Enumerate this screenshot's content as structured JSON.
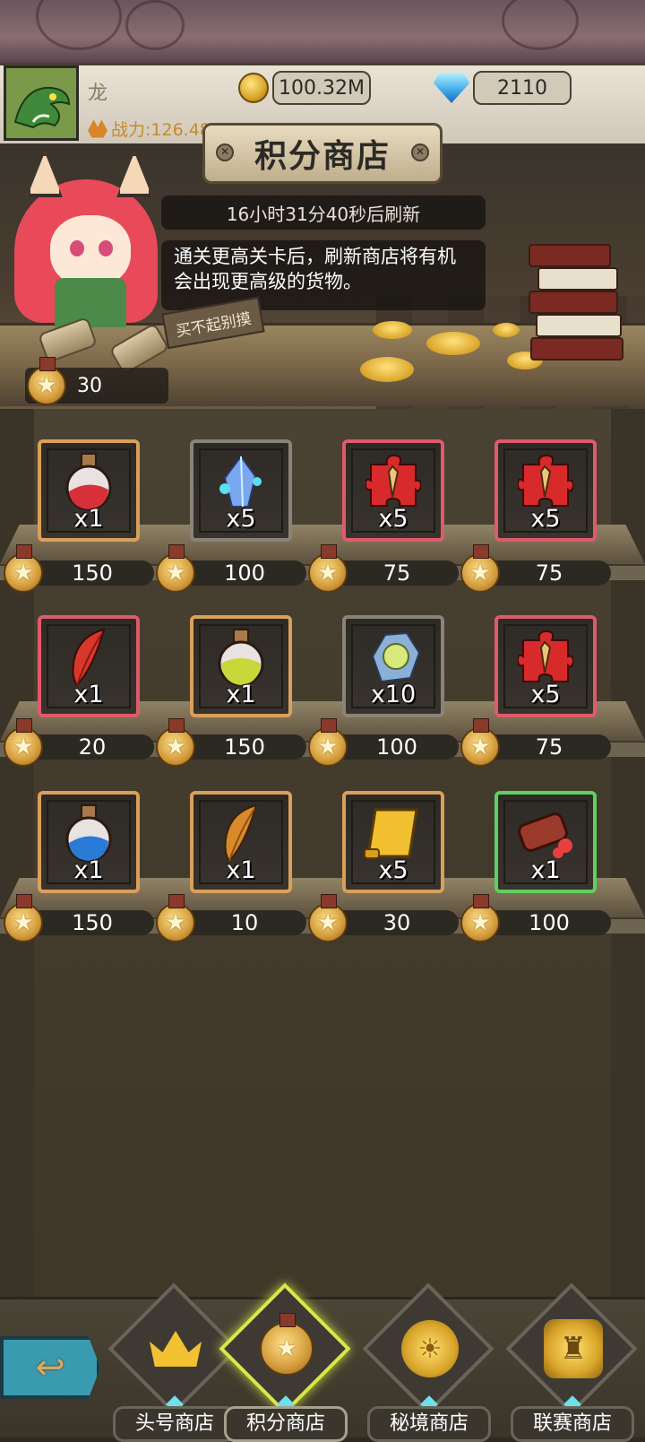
{
  "player": {
    "name": "龙",
    "power": "战力:126.48K"
  },
  "currency": {
    "gold": "100.32M",
    "gems": "2110"
  },
  "shop": {
    "title": "积分商店",
    "refresh_text": "16小时31分40秒后刷新",
    "dialog": "通关更高关卡后，刷新商店将有机会出现更高级的货物。",
    "sign": "买不起别摸",
    "points": "30",
    "items": [
      {
        "icon": "red-potion-icon",
        "qty": "x1",
        "price": "150",
        "rarity": "orange"
      },
      {
        "icon": "blue-crystal-icon",
        "qty": "x5",
        "price": "100",
        "rarity": "gray"
      },
      {
        "icon": "red-puzzle-shard-icon",
        "qty": "x5",
        "price": "75",
        "rarity": "red"
      },
      {
        "icon": "red-puzzle-shard-icon",
        "qty": "x5",
        "price": "75",
        "rarity": "red"
      },
      {
        "icon": "red-feather-icon",
        "qty": "x1",
        "price": "20",
        "rarity": "red"
      },
      {
        "icon": "yellow-potion-icon",
        "qty": "x1",
        "price": "150",
        "rarity": "orange"
      },
      {
        "icon": "gem-ore-icon",
        "qty": "x10",
        "price": "100",
        "rarity": "gray"
      },
      {
        "icon": "red-puzzle-shard-icon",
        "qty": "x5",
        "price": "75",
        "rarity": "red"
      },
      {
        "icon": "blue-potion-icon",
        "qty": "x1",
        "price": "150",
        "rarity": "orange"
      },
      {
        "icon": "orange-feather-icon",
        "qty": "x1",
        "price": "10",
        "rarity": "orange"
      },
      {
        "icon": "gold-scroll-icon",
        "qty": "x5",
        "price": "30",
        "rarity": "orange"
      },
      {
        "icon": "red-scroll-icon",
        "qty": "x1",
        "price": "100",
        "rarity": "green"
      }
    ]
  },
  "nav": {
    "tabs": [
      {
        "label": "头号商店",
        "icon": "crown-icon"
      },
      {
        "label": "积分商店",
        "icon": "star-medal-icon",
        "active": true
      },
      {
        "label": "秘境商店",
        "icon": "sun-coin-icon"
      },
      {
        "label": "联赛商店",
        "icon": "chess-coin-icon"
      }
    ]
  },
  "colors": {
    "orange": "#d9a05a",
    "gray": "#8a8478",
    "red": "#e05a6a",
    "green": "#5ed05e"
  }
}
